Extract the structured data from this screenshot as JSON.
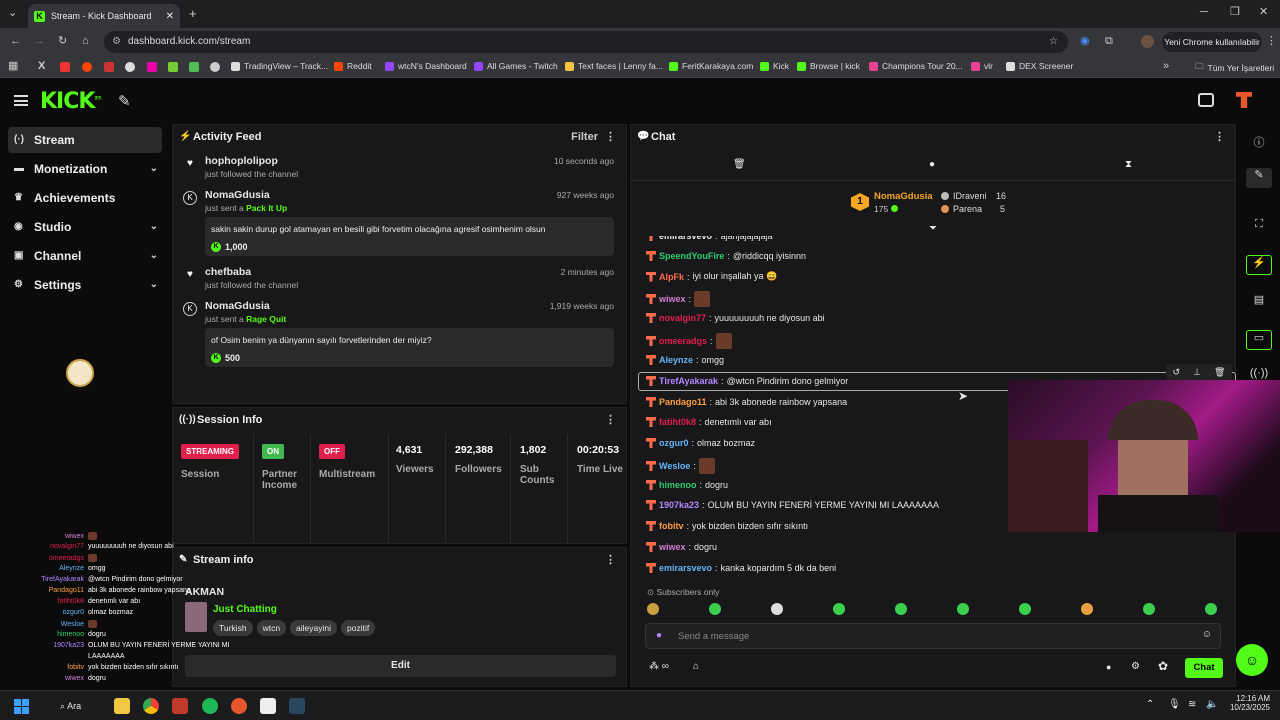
{
  "browser": {
    "tab_title": "Stream - Kick Dashboard",
    "url": "dashboard.kick.com/stream",
    "profile_label": "Yeni Chrome kullanılabilir"
  },
  "bookmarks": [
    "TradingView – Track...",
    "Reddit",
    "wtcN's Dashboard",
    "All Games - Twitch",
    "Text faces | Lenny fa...",
    "FeritKarakaya.com",
    "Kick",
    "Browse | kick",
    "Champions Tour 20...",
    "vlr",
    "DEX Screener"
  ],
  "bookmarks_all": "Tüm Yer İşaretleri",
  "logo": "KICK",
  "logo_beta": "BETA",
  "nav": [
    {
      "label": "Stream"
    },
    {
      "label": "Monetization"
    },
    {
      "label": "Achievements"
    },
    {
      "label": "Studio"
    },
    {
      "label": "Channel"
    },
    {
      "label": "Settings"
    }
  ],
  "activity": {
    "title": "Activity Feed",
    "filter": "Filter",
    "items": [
      {
        "name": "hophoplolipop",
        "sub": "just followed the channel",
        "time": "10 seconds ago"
      },
      {
        "name": "NomaGdusia",
        "sub_pre": "just sent a ",
        "sub_item": "Pack It Up",
        "time": "927 weeks ago",
        "message": "sakin sakin durup gol atamayan en besili gibi forvetim olacağına agresif osimhenim olsun",
        "amount": "1,000"
      },
      {
        "name": "chefbaba",
        "sub": "just followed the channel",
        "time": "2 minutes ago"
      },
      {
        "name": "NomaGdusia",
        "sub_pre": "just sent a ",
        "sub_item": "Rage Quit",
        "time": "1,919 weeks ago",
        "message": "of Osim benim ya dünyanın sayılı forvetlerinden der miyiz?",
        "amount": "500"
      }
    ]
  },
  "session": {
    "title": "Session Info",
    "stats": [
      {
        "badge": "STREAMING",
        "label": "Session",
        "color": "#e01f4b"
      },
      {
        "badge": "ON",
        "label": "Partner Income",
        "color": "#3fb950"
      },
      {
        "badge": "OFF",
        "label": "Multistream",
        "color": "#e01f4b"
      }
    ],
    "numbers": [
      {
        "value": "4,631",
        "label": "Viewers"
      },
      {
        "value": "292,388",
        "label": "Followers"
      },
      {
        "value": "1,802",
        "label": "Sub Counts"
      },
      {
        "value": "00:20:53",
        "label": "Time Live"
      }
    ]
  },
  "stream_info": {
    "title": "Stream info",
    "stream_title": "AKMAN",
    "category": "Just Chatting",
    "tags": [
      "Turkish",
      "wtcn",
      "aileyayini",
      "pozitif"
    ],
    "edit": "Edit"
  },
  "chat": {
    "title": "Chat",
    "leaderboard": [
      {
        "rank": "1",
        "name": "NomaGdusia",
        "count": "175"
      },
      {
        "name": "IDraveni",
        "count": "16"
      },
      {
        "name": "Parena",
        "count": "5"
      }
    ],
    "messages": [
      {
        "user": "emirarsvevo",
        "text": "ajanjajajajaja",
        "color": "#e8e8e8"
      },
      {
        "user": "SpeendYouFire",
        "text": "@riddicqq iyisinnn",
        "color": "#2ecc71"
      },
      {
        "user": "AlpFk",
        "text": "iyi olur inşallah ya 😄",
        "color": "#ff6b4a"
      },
      {
        "user": "wiwex",
        "text": "",
        "color": "#d57dd6"
      },
      {
        "user": "novalgin77",
        "text": "yuuuuuuuuh ne diyosun abi",
        "color": "#e01f4b"
      },
      {
        "user": "omeeradgs",
        "text": "",
        "color": "#e01f4b"
      },
      {
        "user": "Aleynze",
        "text": "omgg",
        "color": "#64b5f6"
      },
      {
        "user": "TirefAyakarak",
        "text": "@wtcn Pindirim dono gelmiyor",
        "color": "#b388ff"
      },
      {
        "user": "Pandago11",
        "text": "abi 3k abonede rainbow yapsana",
        "color": "#ff9f43"
      },
      {
        "user": "fatiht0k8",
        "text": "denetımlı var abı",
        "color": "#e01f4b"
      },
      {
        "user": "ozgur0",
        "text": "olmaz bozmaz",
        "color": "#64b5f6"
      },
      {
        "user": "Wesloe",
        "text": "",
        "color": "#64b5f6"
      },
      {
        "user": "himenoo",
        "text": "dogru",
        "color": "#2ecc71"
      },
      {
        "user": "1907ka23",
        "text": "OLUM BU YAYIN FENERİ YERME YAYINI MI LAAAAAAA",
        "color": "#b388ff"
      },
      {
        "user": "fobitv",
        "text": "yok bizden bizden sıfır sıkıntı",
        "color": "#ff9f43"
      },
      {
        "user": "wiwex",
        "text": "dogru",
        "color": "#d57dd6"
      },
      {
        "user": "emirarsvevo",
        "text": "kanka kopardım 5 dk da beni",
        "color": "#64b5f6"
      }
    ],
    "subscribers_only": "Subscribers only",
    "placeholder": "Send a message",
    "send": "Chat"
  },
  "overlay_chat": [
    {
      "user": "wiwex",
      "text": "",
      "color": "#d57dd6"
    },
    {
      "user": "novalgin77",
      "text": "yuuuuuuuuh ne diyosun abi",
      "color": "#e01f4b"
    },
    {
      "user": "omeeradgs",
      "text": "",
      "color": "#e01f4b"
    },
    {
      "user": "Aleynze",
      "text": "omgg",
      "color": "#64b5f6"
    },
    {
      "user": "TirefAyakarak",
      "text": "@wtcn Pindirim dono gelmiyor",
      "color": "#b388ff"
    },
    {
      "user": "Pandago11",
      "text": "abi 3k abonede rainbow yapsana",
      "color": "#ff9f43"
    },
    {
      "user": "fatiht0k8",
      "text": "denetımlı var abı",
      "color": "#e01f4b"
    },
    {
      "user": "ozgur0",
      "text": "olmaz bozmaz",
      "color": "#64b5f6"
    },
    {
      "user": "Wesloe",
      "text": "",
      "color": "#64b5f6"
    },
    {
      "user": "himenoo",
      "text": "dogru",
      "color": "#2ecc71"
    },
    {
      "user": "1907ka23",
      "text": "OLUM BU YAYIN FENERİ YERME YAYINI MI",
      "color": "#b388ff"
    },
    {
      "user": "",
      "text": "LAAAAAAA",
      "color": "#b388ff"
    },
    {
      "user": "fobitv",
      "text": "yok bizden bizden sıfır sıkıntı",
      "color": "#ff9f43"
    },
    {
      "user": "wiwex",
      "text": "dogru",
      "color": "#d57dd6"
    }
  ],
  "taskbar": {
    "search": "Ara",
    "time": "12:16 AM",
    "date": "10/23/2025"
  }
}
